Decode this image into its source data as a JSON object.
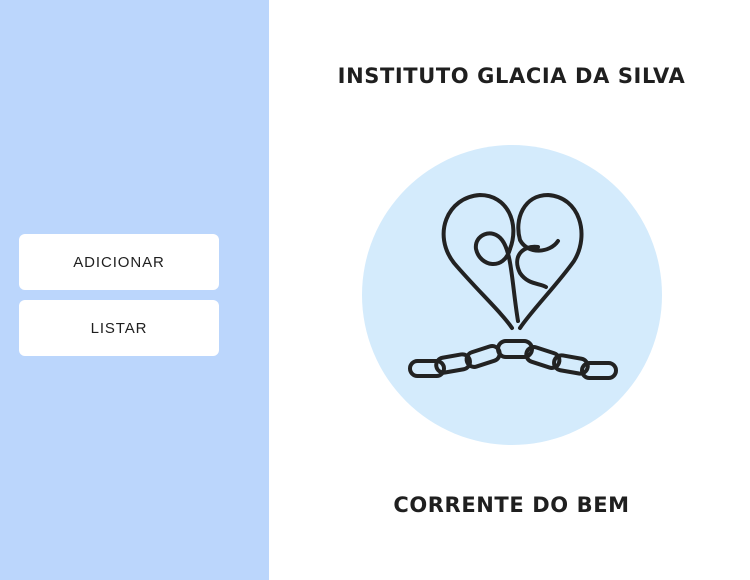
{
  "sidebar": {
    "buttons": [
      {
        "label": "ADICIONAR"
      },
      {
        "label": "LISTAR"
      }
    ]
  },
  "main": {
    "title": "INSTITUTO GLACIA DA SILVA",
    "logo_icon": "heart-chain-logo",
    "slogan": "CORRENTE DO BEM"
  },
  "colors": {
    "sidebar_bg": "#bbd6fc",
    "logo_circle_bg": "#d4ebfc",
    "text": "#1f1f1f",
    "button_bg": "#ffffff"
  }
}
